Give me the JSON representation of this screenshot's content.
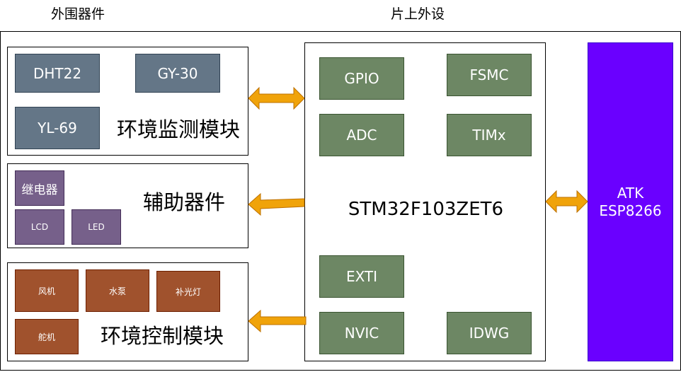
{
  "headers": {
    "external": "外围器件",
    "onchip": "片上外设"
  },
  "env_monitor": {
    "title": "环境监测模块",
    "sensors": [
      "DHT22",
      "GY-30",
      "YL-69"
    ]
  },
  "aux_devices": {
    "title": "辅助器件",
    "items": [
      "继电器",
      "LCD",
      "LED"
    ]
  },
  "env_control": {
    "title": "环境控制模块",
    "items": [
      "风机",
      "水泵",
      "补光灯",
      "舵机"
    ]
  },
  "mcu": {
    "name": "STM32F103ZET6",
    "peripherals": [
      "GPIO",
      "FSMC",
      "ADC",
      "TIMx",
      "EXTI",
      "NVIC",
      "IDWG"
    ]
  },
  "wifi": {
    "line1": "ATK",
    "line2": "ESP8266"
  },
  "colors": {
    "sensor": "#647687",
    "aux": "#76608a",
    "control": "#a0522d",
    "peripheral": "#6d8764",
    "wifi": "#6a00ff",
    "arrow": "#f0a30a"
  }
}
